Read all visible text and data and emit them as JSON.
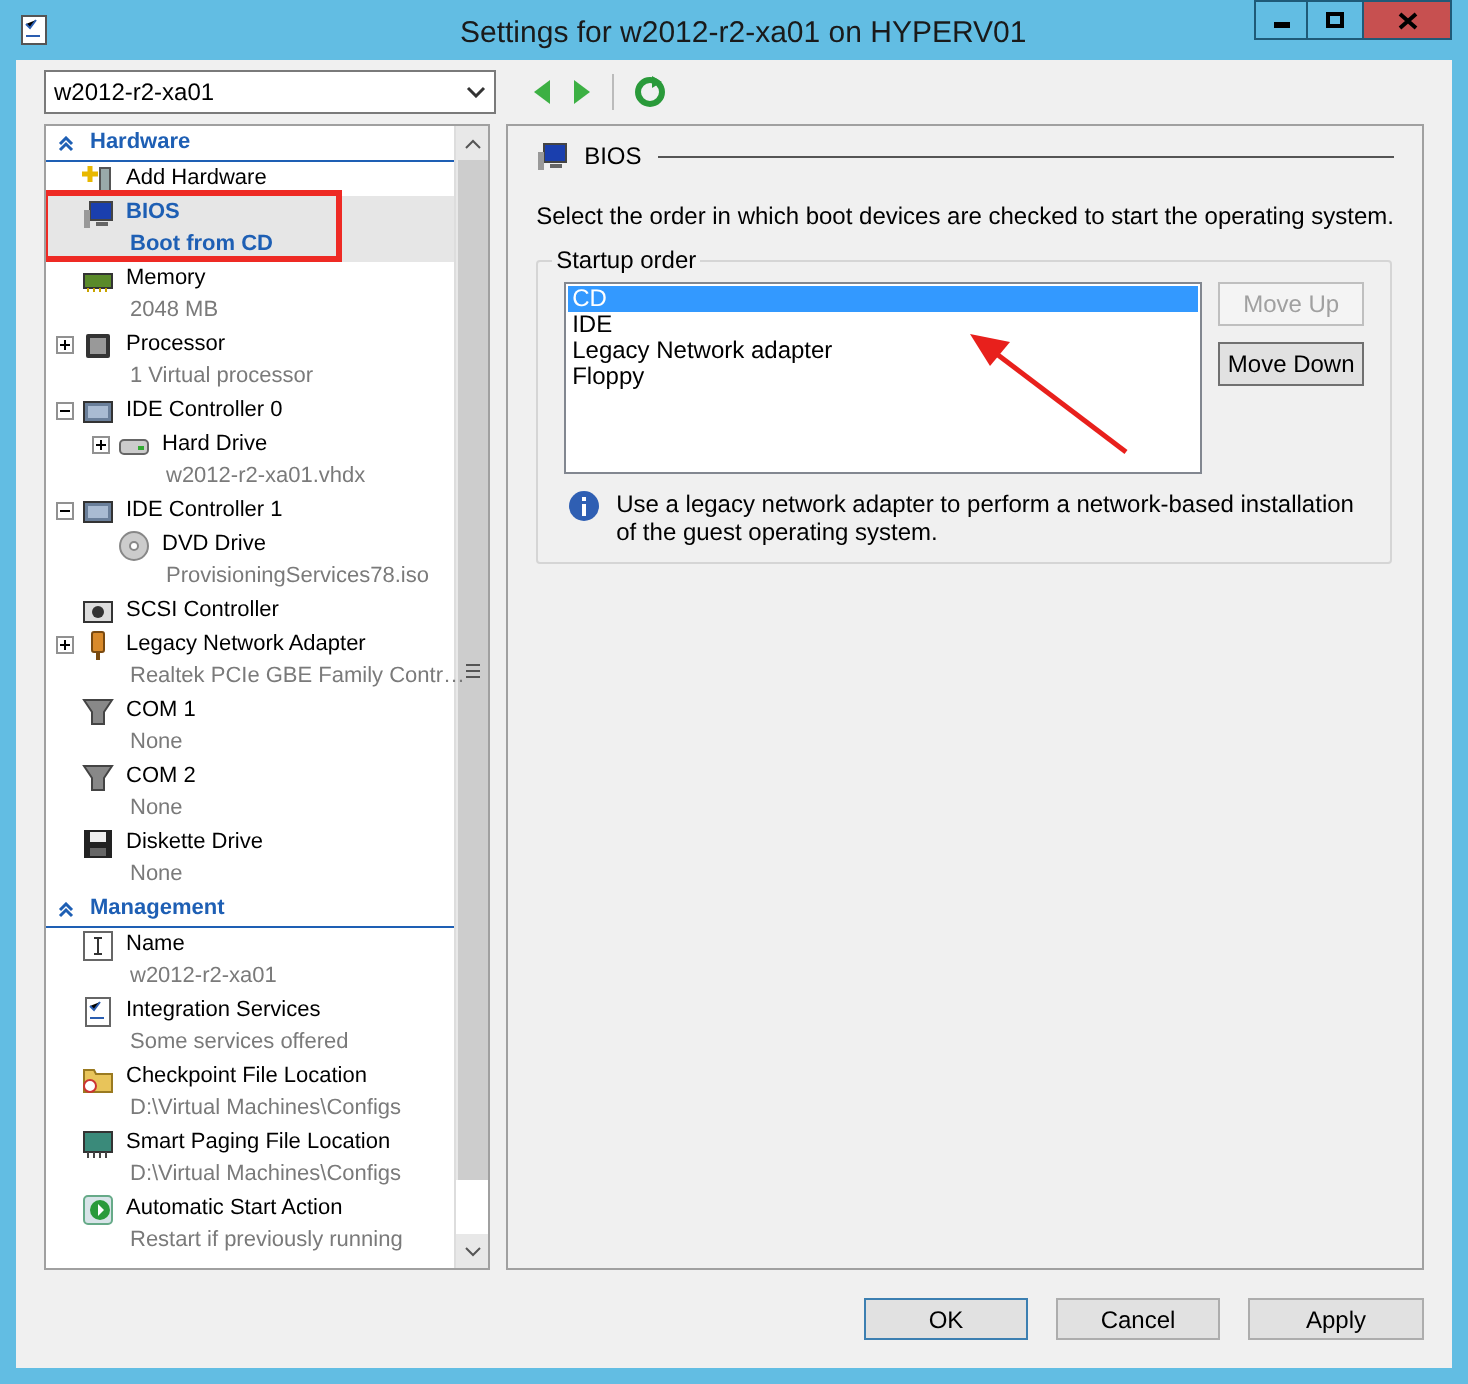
{
  "window": {
    "title": "Settings for w2012-r2-xa01 on HYPERV01"
  },
  "toolbar": {
    "vm_select": {
      "value": "w2012-r2-xa01"
    }
  },
  "sidebar": {
    "sections": [
      {
        "title": "Hardware",
        "expanded": true,
        "items": [
          {
            "title": "Add Hardware",
            "selected": false
          },
          {
            "title": "BIOS",
            "subtitle": "Boot from CD",
            "selected": true
          },
          {
            "title": "Memory",
            "subtitle": "2048 MB",
            "selected": false
          },
          {
            "title": "Processor",
            "subtitle": "1 Virtual processor",
            "selected": false,
            "expanded": false
          },
          {
            "title": "IDE Controller 0",
            "selected": false,
            "expanded": true,
            "children": [
              {
                "title": "Hard Drive",
                "subtitle": "w2012-r2-xa01.vhdx",
                "selected": false,
                "expanded": false
              }
            ]
          },
          {
            "title": "IDE Controller 1",
            "selected": false,
            "expanded": true,
            "children": [
              {
                "title": "DVD Drive",
                "subtitle": "ProvisioningServices78.iso",
                "selected": false
              }
            ]
          },
          {
            "title": "SCSI Controller",
            "selected": false
          },
          {
            "title": "Legacy Network Adapter",
            "subtitle": "Realtek PCIe GBE Family Contr…",
            "selected": false,
            "expanded": false
          },
          {
            "title": "COM 1",
            "subtitle": "None",
            "selected": false
          },
          {
            "title": "COM 2",
            "subtitle": "None",
            "selected": false
          },
          {
            "title": "Diskette Drive",
            "subtitle": "None",
            "selected": false
          }
        ]
      },
      {
        "title": "Management",
        "expanded": true,
        "items": [
          {
            "title": "Name",
            "subtitle": "w2012-r2-xa01",
            "selected": false
          },
          {
            "title": "Integration Services",
            "subtitle": "Some services offered",
            "selected": false
          },
          {
            "title": "Checkpoint File Location",
            "subtitle": "D:\\Virtual Machines\\Configs",
            "selected": false
          },
          {
            "title": "Smart Paging File Location",
            "subtitle": "D:\\Virtual Machines\\Configs",
            "selected": false
          },
          {
            "title": "Automatic Start Action",
            "subtitle": "Restart if previously running",
            "selected": false
          }
        ]
      }
    ]
  },
  "panel": {
    "heading": "BIOS",
    "description": "Select the order in which boot devices are checked to start the operating system.",
    "group": {
      "title": "Startup order",
      "boot_order": [
        {
          "label": "CD",
          "selected": true
        },
        {
          "label": "IDE",
          "selected": false
        },
        {
          "label": "Legacy Network adapter",
          "selected": false
        },
        {
          "label": "Floppy",
          "selected": false
        }
      ],
      "buttons": [
        {
          "label": "Move Up",
          "disabled": true
        },
        {
          "label": "Move Down",
          "disabled": false
        }
      ],
      "info": "Use a legacy network adapter to perform a network-based installation of the guest operating system."
    }
  },
  "footer": {
    "buttons": [
      "OK",
      "Cancel",
      "Apply"
    ]
  }
}
